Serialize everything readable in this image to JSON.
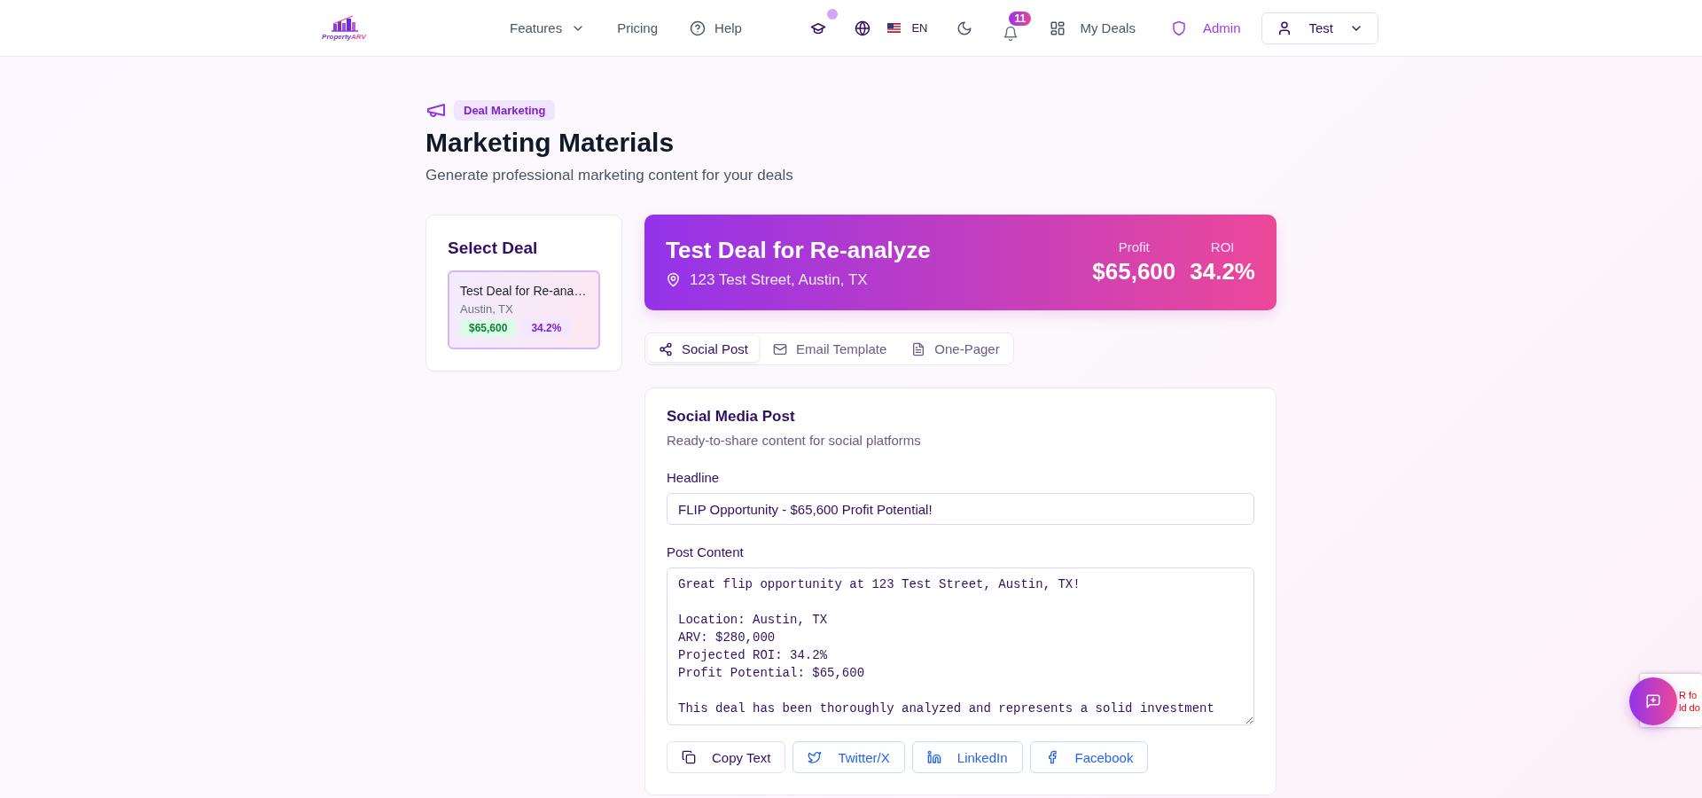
{
  "header": {
    "logo_text": [
      "Property",
      "ARV"
    ],
    "nav": [
      {
        "label": "Features",
        "kind": "dropdown"
      },
      {
        "label": "Pricing",
        "kind": "plain"
      },
      {
        "label": "Help",
        "kind": "help"
      }
    ],
    "language": "EN",
    "notification_count": "11",
    "my_deals": "My Deals",
    "admin": "Admin",
    "user": "Test"
  },
  "page": {
    "badge": "Deal Marketing",
    "title": "Marketing Materials",
    "subtitle": "Generate professional marketing content for your deals"
  },
  "select_deal": {
    "title": "Select Deal",
    "deals": [
      {
        "name": "Test Deal for Re-ana…",
        "location": "Austin, TX",
        "profit": "$65,600",
        "roi": "34.2%",
        "selected": true
      }
    ]
  },
  "banner": {
    "title": "Test Deal for Re-analyze",
    "address": "123 Test Street, Austin, TX",
    "stats": [
      {
        "label": "Profit",
        "value": "$65,600"
      },
      {
        "label": "ROI",
        "value": "34.2%"
      }
    ]
  },
  "tabs": [
    {
      "label": "Social Post",
      "kind": "share",
      "selected": true
    },
    {
      "label": "Email Template",
      "kind": "mail",
      "selected": false
    },
    {
      "label": "One-Pager",
      "kind": "file",
      "selected": false
    }
  ],
  "social_card": {
    "title": "Social Media Post",
    "subtitle": "Ready-to-share content for social platforms",
    "headline_label": "Headline",
    "headline": "FLIP Opportunity - $65,600 Profit Potential!",
    "content_label": "Post Content",
    "content": "Great flip opportunity at 123 Test Street, Austin, TX!\n\nLocation: Austin, TX\nARV: $280,000\nProjected ROI: 34.2%\nProfit Potential: $65,600\n\nThis deal has been thoroughly analyzed and represents a solid investment",
    "buttons": [
      {
        "label": "Copy Text",
        "kind": "copy"
      },
      {
        "label": "Twitter/X",
        "kind": "twitter"
      },
      {
        "label": "LinkedIn",
        "kind": "linkedin"
      },
      {
        "label": "Facebook",
        "kind": "facebook"
      }
    ]
  },
  "captcha_notice": [
    "R fo",
    "ld do"
  ]
}
